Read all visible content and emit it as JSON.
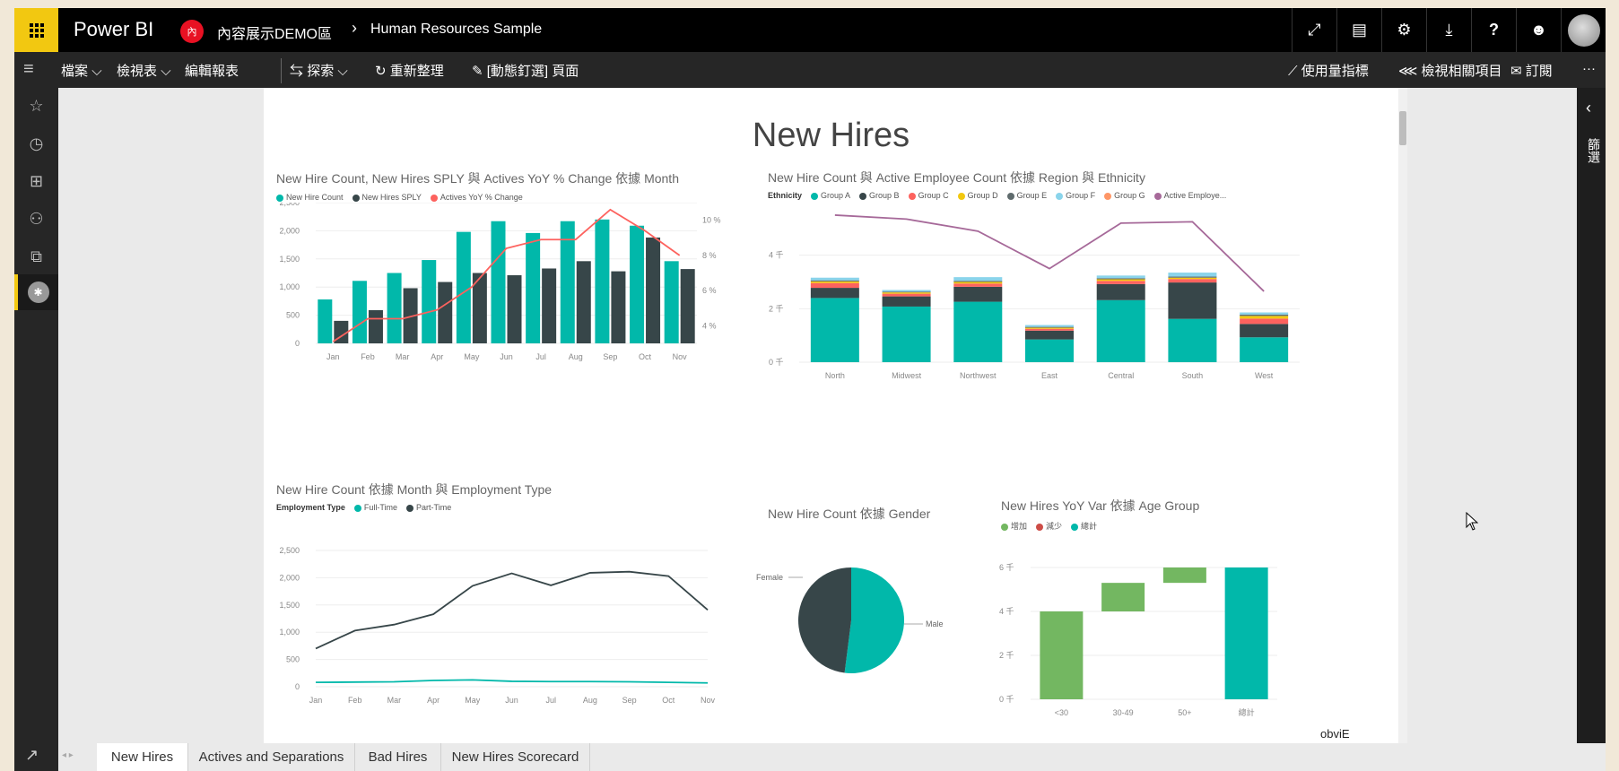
{
  "app": {
    "brand": "Power BI",
    "workspace_badge": "內",
    "workspace": "內容展示DEMO區",
    "breadcrumb_sep": "›",
    "report": "Human Resources Sample"
  },
  "topbar_icons": [
    "expand-icon",
    "comment-icon",
    "gear-icon",
    "download-icon",
    "help-icon",
    "smiley-icon"
  ],
  "toolbar": {
    "file": "檔案",
    "view": "檢視表",
    "edit": "編輯報表",
    "explore": "探索",
    "refresh": "重新整理",
    "pin": "[動態釘選] 頁面",
    "usage": "使用量指標",
    "related": "檢視相關項目",
    "subscribe": "訂閱",
    "more": "···"
  },
  "right_panel": {
    "label": "篩選",
    "collapse": "‹"
  },
  "page": {
    "title": "New Hires",
    "watermark": "obviE"
  },
  "tabs": [
    "New Hires",
    "Actives and Separations",
    "Bad Hires",
    "New Hires Scorecard"
  ],
  "visual1": {
    "title": "New Hire Count, New Hires SPLY 與 Actives YoY % Change 依據 Month",
    "legend": [
      {
        "name": "New Hire Count",
        "color": "#01b8aa"
      },
      {
        "name": "New Hires SPLY",
        "color": "#374649"
      },
      {
        "name": "Actives YoY % Change",
        "color": "#fd625e"
      }
    ],
    "chart_data": {
      "type": "bar",
      "categories": [
        "Jan",
        "Feb",
        "Mar",
        "Apr",
        "May",
        "Jun",
        "Jul",
        "Aug",
        "Sep",
        "Oct",
        "Nov"
      ],
      "series": [
        {
          "name": "New Hire Count",
          "values": [
            780,
            1110,
            1250,
            1480,
            1980,
            2170,
            1960,
            2170,
            2200,
            2090,
            1460
          ]
        },
        {
          "name": "New Hires SPLY",
          "values": [
            400,
            590,
            980,
            1090,
            1250,
            1210,
            1330,
            1460,
            1280,
            1880,
            1320
          ]
        },
        {
          "name": "Actives YoY % Change",
          "values": [
            3.1,
            4.4,
            4.4,
            4.9,
            6.2,
            8.4,
            8.9,
            8.9,
            10.6,
            9.4,
            8.0
          ]
        }
      ],
      "ylim": [
        0,
        2500
      ],
      "y_ticks": [
        "0",
        "500",
        "1,000",
        "1,500",
        "2,000",
        "2,500"
      ],
      "y2lim": [
        3,
        11
      ],
      "y2_ticks": [
        "4 %",
        "6 %",
        "8 %",
        "10 %"
      ]
    }
  },
  "visual2": {
    "title": "New Hire Count 與 Active Employee Count 依據 Region 與 Ethnicity",
    "legend_title": "Ethnicity",
    "legend": [
      {
        "name": "Group A",
        "color": "#01b8aa"
      },
      {
        "name": "Group B",
        "color": "#374649"
      },
      {
        "name": "Group C",
        "color": "#fd625e"
      },
      {
        "name": "Group D",
        "color": "#f2c80f"
      },
      {
        "name": "Group E",
        "color": "#5f6b6d"
      },
      {
        "name": "Group F",
        "color": "#8ad4eb"
      },
      {
        "name": "Group G",
        "color": "#fe9666"
      },
      {
        "name": "Active Employe...",
        "color": "#a66999"
      }
    ],
    "chart_data": {
      "type": "bar",
      "stacked": true,
      "categories": [
        "North",
        "Midwest",
        "Northwest",
        "East",
        "Central",
        "South",
        "West"
      ],
      "series": [
        {
          "name": "Group A",
          "values": [
            2.4,
            2.08,
            2.26,
            0.85,
            2.32,
            1.62,
            0.93
          ]
        },
        {
          "name": "Group B",
          "values": [
            0.38,
            0.38,
            0.56,
            0.33,
            0.6,
            1.36,
            0.5
          ]
        },
        {
          "name": "Group C",
          "values": [
            0.18,
            0.1,
            0.12,
            0.07,
            0.12,
            0.13,
            0.2
          ]
        },
        {
          "name": "Group D",
          "values": [
            0.06,
            0.05,
            0.06,
            0.04,
            0.06,
            0.05,
            0.1
          ]
        },
        {
          "name": "Group E",
          "values": [
            0.04,
            0.03,
            0.04,
            0.03,
            0.04,
            0.04,
            0.05
          ]
        },
        {
          "name": "Group F",
          "values": [
            0.1,
            0.06,
            0.14,
            0.07,
            0.1,
            0.15,
            0.08
          ]
        },
        {
          "name": "Group G",
          "values": [
            0,
            0,
            0,
            0,
            0,
            0,
            0
          ]
        }
      ],
      "line": {
        "name": "Active Employe...",
        "values": [
          5.5,
          5.35,
          4.9,
          3.5,
          5.2,
          5.25,
          2.65
        ]
      },
      "ylim": [
        0,
        6
      ],
      "y_ticks": [
        "0 千",
        "2 千",
        "4 千"
      ]
    }
  },
  "visual3": {
    "title": "New Hire Count 依據 Month 與 Employment Type",
    "legend_title": "Employment Type",
    "legend": [
      {
        "name": "Full-Time",
        "color": "#01b8aa"
      },
      {
        "name": "Part-Time",
        "color": "#374649"
      }
    ],
    "chart_data": {
      "type": "line",
      "categories": [
        "Jan",
        "Feb",
        "Mar",
        "Apr",
        "May",
        "Jun",
        "Jul",
        "Aug",
        "Sep",
        "Oct",
        "Nov"
      ],
      "series": [
        {
          "name": "Full-Time",
          "values": [
            80,
            85,
            90,
            115,
            125,
            100,
            95,
            95,
            90,
            80,
            70
          ]
        },
        {
          "name": "Part-Time",
          "values": [
            700,
            1030,
            1140,
            1330,
            1850,
            2080,
            1860,
            2090,
            2110,
            2030,
            1410
          ]
        }
      ],
      "ylim": [
        0,
        2500
      ],
      "y_ticks": [
        "0",
        "500",
        "1,000",
        "1,500",
        "2,000",
        "2,500"
      ]
    }
  },
  "visual4": {
    "title": "New Hire Count 依據 Gender",
    "chart_data": {
      "type": "pie",
      "labels": [
        "Male",
        "Female"
      ],
      "values": [
        52,
        48
      ],
      "colors": [
        "#01b8aa",
        "#374649"
      ]
    }
  },
  "visual5": {
    "title": "New Hires YoY Var 依據 Age Group",
    "legend": [
      {
        "name": "增加",
        "color": "#73b761"
      },
      {
        "name": "減少",
        "color": "#cd4c46"
      },
      {
        "name": "總計",
        "color": "#01b8aa"
      }
    ],
    "chart_data": {
      "type": "bar",
      "waterfall": true,
      "categories": [
        "<30",
        "30-49",
        "50+",
        "總計"
      ],
      "steps": [
        {
          "start": 0,
          "end": 4.0
        },
        {
          "start": 4.0,
          "end": 5.3
        },
        {
          "start": 5.3,
          "end": 6.0
        },
        {
          "start": 0,
          "end": 6.0
        }
      ],
      "ylim": [
        0,
        6
      ],
      "y_ticks": [
        "0 千",
        "2 千",
        "4 千",
        "6 千"
      ]
    }
  }
}
